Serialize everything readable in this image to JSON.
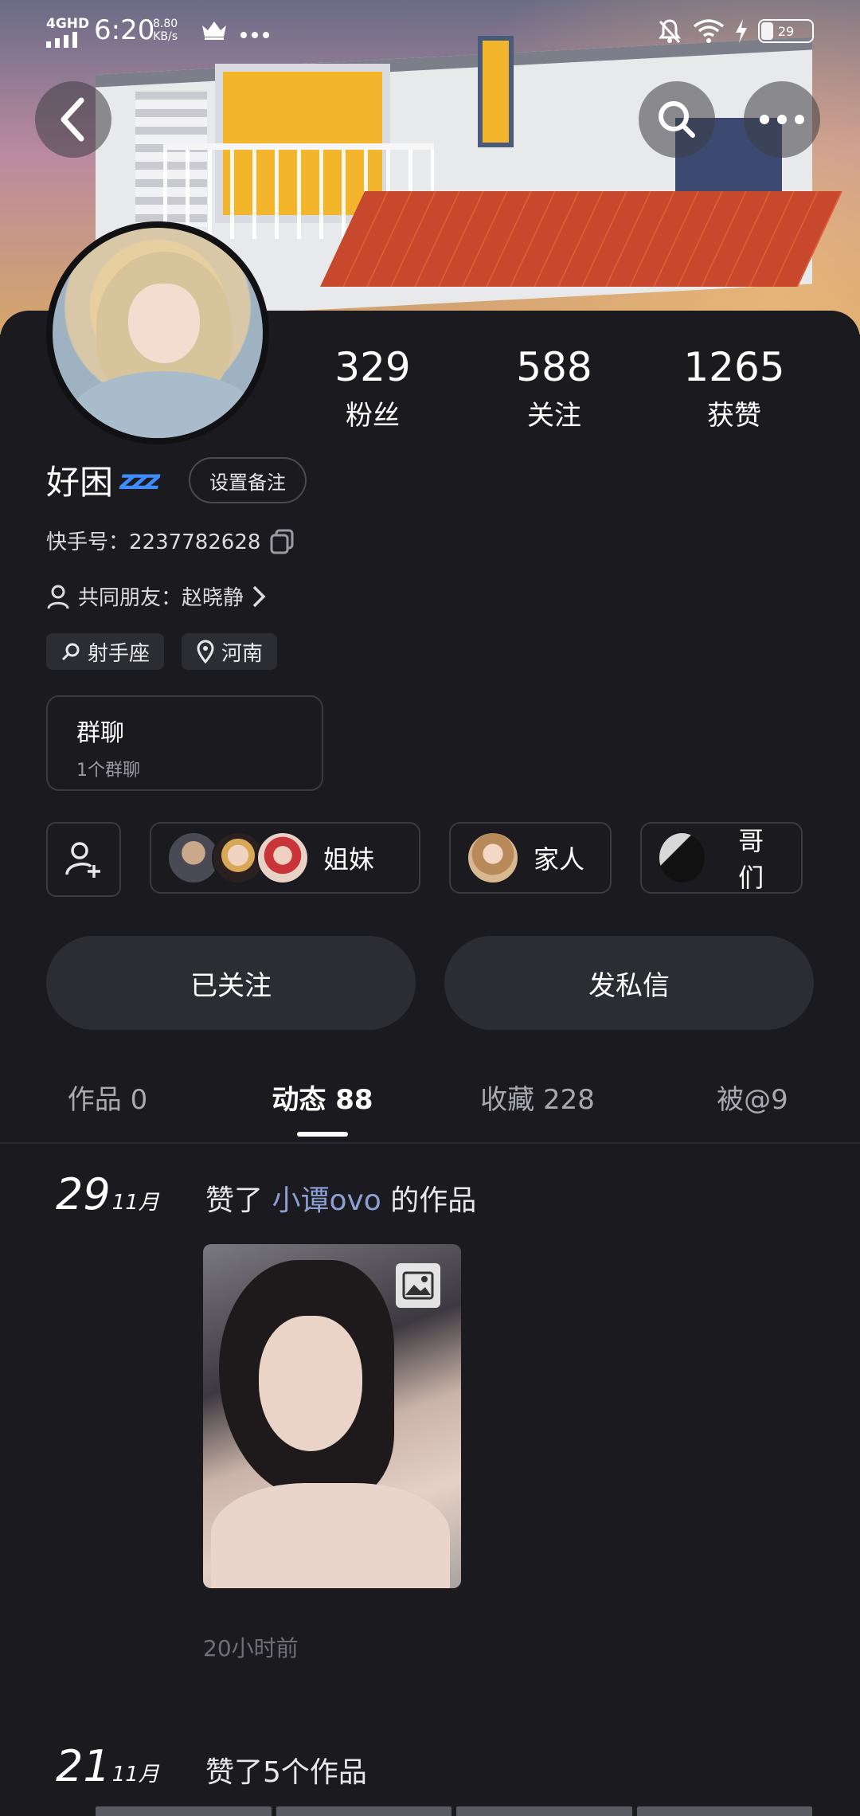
{
  "status_bar": {
    "network": "4GHD",
    "time": "6:20",
    "speed_value": "8.80",
    "speed_unit": "KB/s",
    "battery": "29"
  },
  "profile": {
    "nickname": "好困",
    "remark_button": "设置备注",
    "kuaishou_id": "快手号：2237782628",
    "mutual_friends": "共同朋友：赵晓静",
    "tags": [
      "射手座",
      "河南"
    ],
    "stats": [
      {
        "value": "329",
        "label": "粉丝"
      },
      {
        "value": "588",
        "label": "关注"
      },
      {
        "value": "1265",
        "label": "获赞"
      }
    ],
    "group_chat": {
      "title": "群聊",
      "subtitle": "1个群聊"
    },
    "circles": [
      {
        "label": "姐妹"
      },
      {
        "label": "家人"
      },
      {
        "label": "哥们"
      }
    ],
    "follow_button": "已关注",
    "message_button": "发私信"
  },
  "tabs": [
    {
      "label": "作品 0",
      "active": false
    },
    {
      "label": "动态 88",
      "active": true
    },
    {
      "label": "收藏 228",
      "active": false
    },
    {
      "label": "被@9",
      "active": false
    }
  ],
  "feed": [
    {
      "day": "29",
      "month": "11月",
      "prefix": "赞了",
      "user": "小谭ovo",
      "suffix": "的作品",
      "time_ago": "20小时前"
    },
    {
      "day": "21",
      "month": "11月",
      "text": "赞了5个作品"
    }
  ],
  "colors": {
    "background": "#1a1a1f",
    "link": "#8da0d6",
    "zzz": "#3f8cff",
    "button": "#2c2c33"
  }
}
